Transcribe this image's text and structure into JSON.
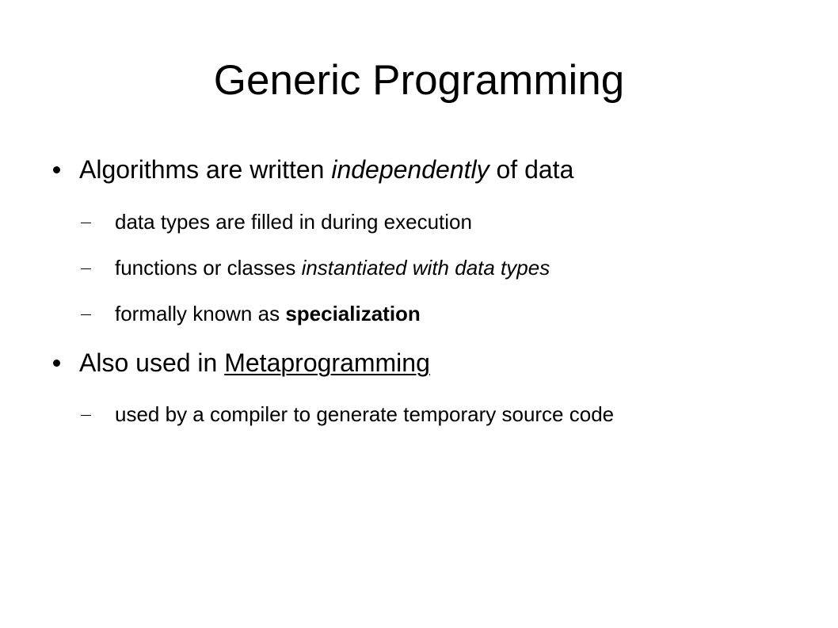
{
  "slide": {
    "title": "Generic Programming",
    "bullets": [
      {
        "parts": [
          "Algorithms are written ",
          "independently",
          " of data"
        ],
        "subs": [
          {
            "parts": [
              "data types are filled in during execution"
            ]
          },
          {
            "parts": [
              "functions or classes ",
              "instantiated with data types"
            ]
          },
          {
            "parts": [
              "formally known as ",
              "specialization"
            ]
          }
        ]
      },
      {
        "parts": [
          "Also used in ",
          "Metaprogramming"
        ],
        "subs": [
          {
            "parts": [
              "used by a compiler to generate temporary source code"
            ]
          }
        ]
      }
    ]
  }
}
